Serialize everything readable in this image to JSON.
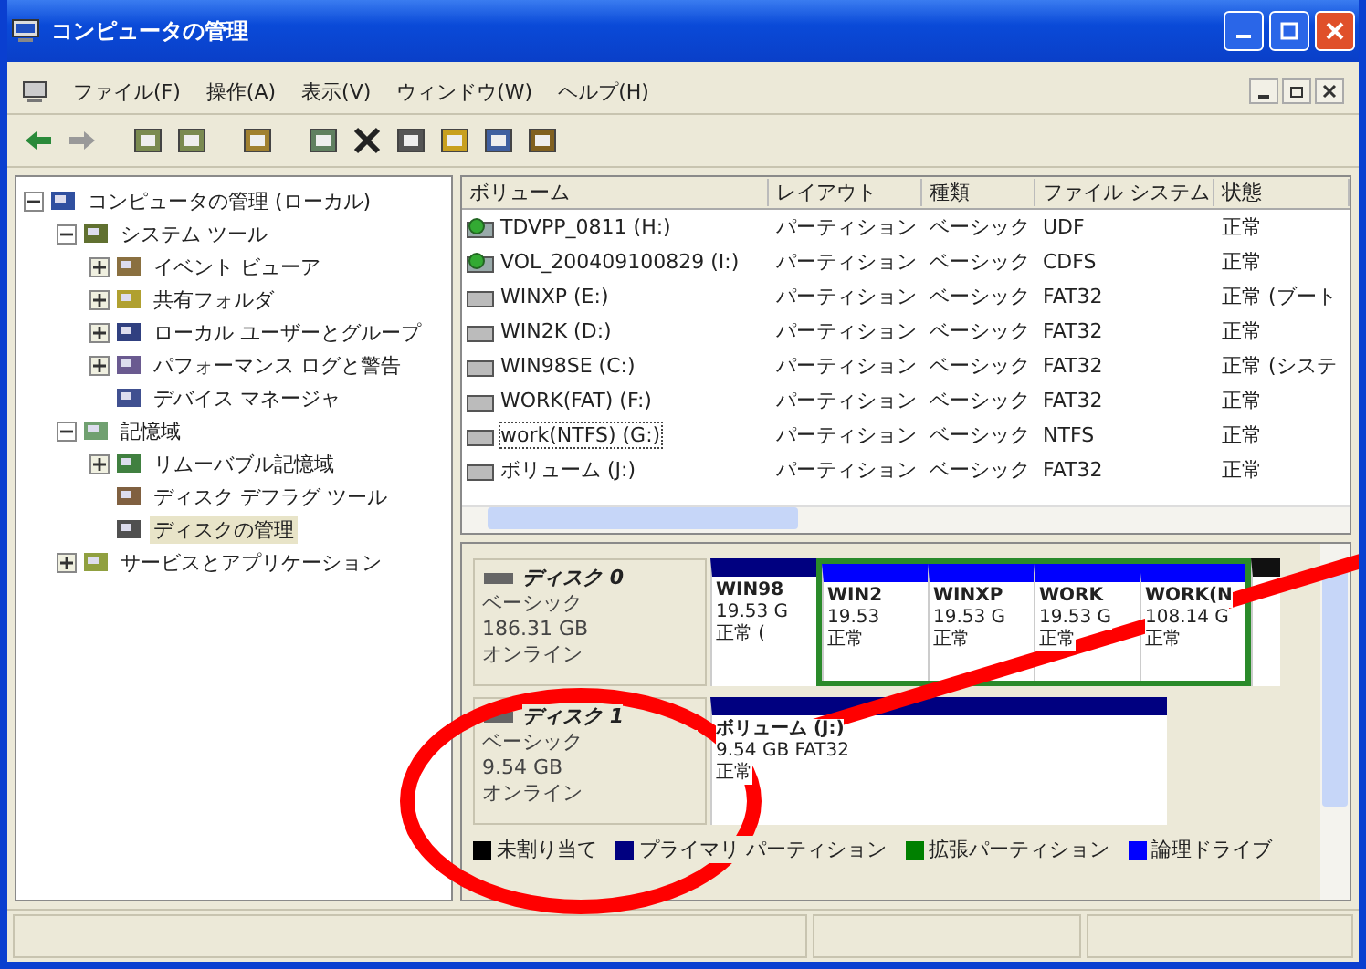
{
  "window": {
    "title": "コンピュータの管理"
  },
  "menu": [
    {
      "label": "ファイル(F)"
    },
    {
      "label": "操作(A)"
    },
    {
      "label": "表示(V)"
    },
    {
      "label": "ウィンドウ(W)"
    },
    {
      "label": "ヘルプ(H)"
    }
  ],
  "tree": [
    {
      "label": "コンピュータの管理 (ローカル)",
      "expanded": true,
      "selected": false,
      "children": [
        {
          "label": "システム ツール",
          "expanded": true,
          "selected": false,
          "children": [
            {
              "label": "イベント ビューア",
              "expanded": false,
              "selected": false
            },
            {
              "label": "共有フォルダ",
              "expanded": false,
              "selected": false
            },
            {
              "label": "ローカル ユーザーとグループ",
              "expanded": false,
              "selected": false
            },
            {
              "label": "パフォーマンス ログと警告",
              "expanded": false,
              "selected": false
            },
            {
              "label": "デバイス マネージャ",
              "selected": false
            }
          ]
        },
        {
          "label": "記憶域",
          "expanded": true,
          "selected": false,
          "children": [
            {
              "label": "リムーバブル記憶域",
              "expanded": false,
              "selected": false
            },
            {
              "label": "ディスク デフラグ ツール",
              "selected": false
            },
            {
              "label": "ディスクの管理",
              "selected": true
            }
          ]
        },
        {
          "label": "サービスとアプリケーション",
          "expanded": false,
          "selected": false
        }
      ]
    }
  ],
  "table": {
    "columns": [
      "ボリューム",
      "レイアウト",
      "種類",
      "ファイル システム",
      "状態"
    ],
    "rows": [
      {
        "kind": "cd",
        "focused": false,
        "cells": [
          "TDVPP_0811 (H:)",
          "パーティション",
          "ベーシック",
          "UDF",
          "正常"
        ]
      },
      {
        "kind": "cd",
        "focused": false,
        "cells": [
          "VOL_200409100829 (I:)",
          "パーティション",
          "ベーシック",
          "CDFS",
          "正常"
        ]
      },
      {
        "kind": "disk",
        "focused": false,
        "cells": [
          "WINXP (E:)",
          "パーティション",
          "ベーシック",
          "FAT32",
          "正常 (ブート"
        ]
      },
      {
        "kind": "disk",
        "focused": false,
        "cells": [
          "WIN2K (D:)",
          "パーティション",
          "ベーシック",
          "FAT32",
          "正常"
        ]
      },
      {
        "kind": "disk",
        "focused": false,
        "cells": [
          "WIN98SE (C:)",
          "パーティション",
          "ベーシック",
          "FAT32",
          "正常 (システ"
        ]
      },
      {
        "kind": "disk",
        "focused": false,
        "cells": [
          "WORK(FAT) (F:)",
          "パーティション",
          "ベーシック",
          "FAT32",
          "正常"
        ]
      },
      {
        "kind": "disk",
        "focused": true,
        "cells": [
          "work(NTFS) (G:)",
          "パーティション",
          "ベーシック",
          "NTFS",
          "正常"
        ]
      },
      {
        "kind": "disk",
        "focused": false,
        "cells": [
          "ボリューム (J:)",
          "パーティション",
          "ベーシック",
          "FAT32",
          "正常"
        ]
      }
    ]
  },
  "disks": [
    {
      "name": "ディスク 0",
      "type": "ベーシック",
      "size": "186.31 GB",
      "status": "オンライン",
      "partitions": [
        {
          "kind": "primary",
          "lines": [
            "WIN98",
            "19.53 G",
            "正常 ("
          ]
        },
        {
          "kind": "extended",
          "children": [
            {
              "kind": "logical",
              "lines": [
                "WIN2",
                "19.53",
                "正常"
              ]
            },
            {
              "kind": "logical",
              "lines": [
                "WINXP",
                "19.53 G",
                "正常"
              ]
            },
            {
              "kind": "logical",
              "lines": [
                "WORK",
                "19.53 G",
                "正常"
              ]
            },
            {
              "kind": "logical",
              "lines": [
                "WORK(N",
                "108.14 G",
                "正常"
              ]
            }
          ]
        },
        {
          "kind": "unallocated"
        }
      ]
    },
    {
      "name": "ディスク 1",
      "type": "ベーシック",
      "size": "9.54 GB",
      "status": "オンライン",
      "partitions": [
        {
          "kind": "primary",
          "lines": [
            "ボリューム (J:)",
            "9.54 GB FAT32",
            "正常"
          ]
        }
      ]
    }
  ],
  "legend": [
    {
      "label": "未割り当て",
      "color": "#000000"
    },
    {
      "label": "プライマリ パーティション",
      "color": "#000080"
    },
    {
      "label": "拡張パーティション",
      "color": "#008000"
    },
    {
      "label": "論理ドライブ",
      "color": "#0000ff"
    }
  ]
}
